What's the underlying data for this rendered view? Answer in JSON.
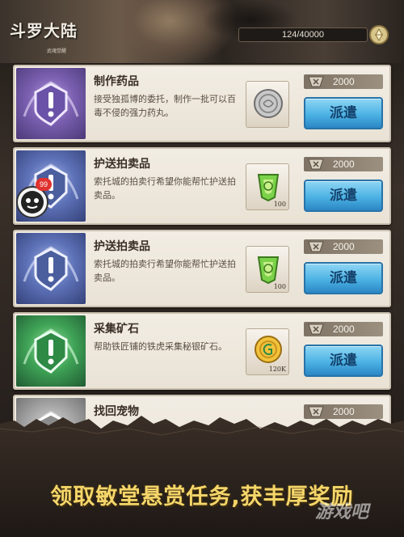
{
  "header": {
    "game_title": "斗罗大陆",
    "game_subtitle": "武魂觉醒",
    "progress_text": "124/40000"
  },
  "missions": [
    {
      "title": "制作药品",
      "desc": "接受独孤博的委托，制作一批可以百毒不侵的强力药丸。",
      "item_icon": "silver-coin-icon",
      "item_qty": "",
      "cost": "2000",
      "button": "派遣",
      "emblem_color": "#7a5fb0"
    },
    {
      "title": "护送拍卖品",
      "desc": "索托城的拍卖行希望你能帮忙护送拍卖品。",
      "item_icon": "green-gem-icon",
      "item_qty": "100",
      "cost": "2000",
      "button": "派遣",
      "emblem_color": "#5e72b8"
    },
    {
      "title": "护送拍卖品",
      "desc": "索托城的拍卖行希望你能帮忙护送拍卖品。",
      "item_icon": "green-gem-icon",
      "item_qty": "100",
      "cost": "2000",
      "button": "派遣",
      "emblem_color": "#5e72b8"
    },
    {
      "title": "采集矿石",
      "desc": "帮助铁匠铺的铁虎采集秘银矿石。",
      "item_icon": "gold-coin-icon",
      "item_qty": "120K",
      "cost": "2000",
      "button": "派遣",
      "emblem_color": "#3fa356"
    },
    {
      "title": "找回宠物",
      "desc": "",
      "item_icon": "",
      "item_qty": "",
      "cost": "2000",
      "button": "",
      "emblem_color": "#a8a8a8"
    }
  ],
  "avatar_badge_count": "99",
  "banner_text": "领取敏堂悬赏任务,获丰厚奖励",
  "watermark": "游戏吧"
}
